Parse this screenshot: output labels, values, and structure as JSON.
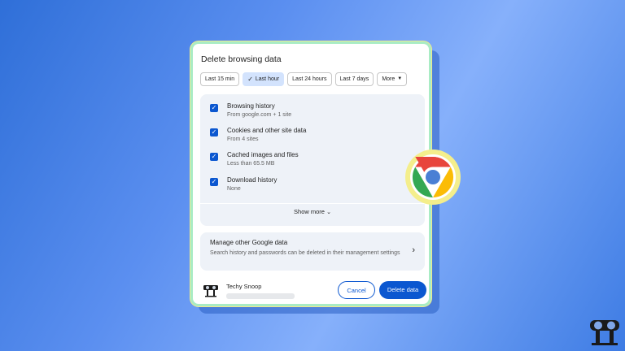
{
  "dialog": {
    "title": "Delete browsing data",
    "time_ranges": [
      {
        "label": "Last 15 min",
        "selected": false
      },
      {
        "label": "Last hour",
        "selected": true
      },
      {
        "label": "Last 24 hours",
        "selected": false
      },
      {
        "label": "Last 7 days",
        "selected": false
      }
    ],
    "more_label": "More",
    "data_types": [
      {
        "label": "Browsing history",
        "sub": "From google.com + 1 site",
        "checked": true
      },
      {
        "label": "Cookies and other site data",
        "sub": "From 4 sites",
        "checked": true
      },
      {
        "label": "Cached images and files",
        "sub": "Less than 65.5 MB",
        "checked": true
      },
      {
        "label": "Download history",
        "sub": "None",
        "checked": true
      }
    ],
    "show_more_label": "Show more",
    "manage": {
      "title": "Manage other Google data",
      "description": "Search history and passwords can be deleted in their management settings"
    },
    "account": {
      "name": "Techy Snoop"
    },
    "cancel_label": "Cancel",
    "delete_label": "Delete data"
  },
  "colors": {
    "accent": "#0b57d0",
    "selected_chip": "#d3e3fd",
    "panel_bg": "#eef2f8"
  },
  "icons": [
    "check-icon",
    "caret-down-icon",
    "checkbox-icon",
    "chevron-down-icon",
    "chevron-right-icon",
    "chrome-logo-icon",
    "binoculars-logo-icon"
  ]
}
